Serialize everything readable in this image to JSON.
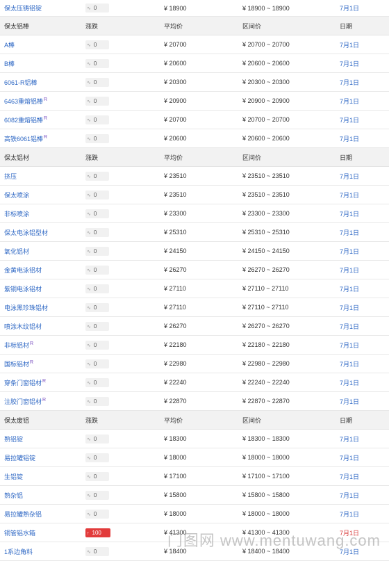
{
  "top_row": {
    "name": "保太压铸铝锭",
    "change": "0",
    "avg": "¥ 18900",
    "range": "¥ 18900 ~ 18900",
    "date": "7月1日"
  },
  "sections": [
    {
      "header": {
        "title": "保太铝棒",
        "change": "涨跌",
        "avg": "平均价",
        "range": "区间价",
        "date": "日期"
      },
      "rows": [
        {
          "name": "A棒",
          "ext": "",
          "change": "0",
          "avg": "¥ 20700",
          "range": "¥ 20700 ~ 20700",
          "date": "7月1日"
        },
        {
          "name": "B棒",
          "ext": "",
          "change": "0",
          "avg": "¥ 20600",
          "range": "¥ 20600 ~ 20600",
          "date": "7月1日"
        },
        {
          "name": "6061-R铝棒",
          "ext": "",
          "change": "0",
          "avg": "¥ 20300",
          "range": "¥ 20300 ~ 20300",
          "date": "7月1日"
        },
        {
          "name": "6463重熔铝棒",
          "ext": "R",
          "change": "0",
          "avg": "¥ 20900",
          "range": "¥ 20900 ~ 20900",
          "date": "7月1日"
        },
        {
          "name": "6082重熔铝棒",
          "ext": "R",
          "change": "0",
          "avg": "¥ 20700",
          "range": "¥ 20700 ~ 20700",
          "date": "7月1日"
        },
        {
          "name": "高铁6061铝棒",
          "ext": "R",
          "change": "0",
          "avg": "¥ 20600",
          "range": "¥ 20600 ~ 20600",
          "date": "7月1日"
        }
      ]
    },
    {
      "header": {
        "title": "保太铝材",
        "change": "涨跌",
        "avg": "平均价",
        "range": "区间价",
        "date": "日期"
      },
      "rows": [
        {
          "name": "挤压",
          "ext": "",
          "change": "0",
          "avg": "¥ 23510",
          "range": "¥ 23510 ~ 23510",
          "date": "7月1日"
        },
        {
          "name": "保太喷涂",
          "ext": "",
          "change": "0",
          "avg": "¥ 23510",
          "range": "¥ 23510 ~ 23510",
          "date": "7月1日"
        },
        {
          "name": "非标喷涂",
          "ext": "",
          "change": "0",
          "avg": "¥ 23300",
          "range": "¥ 23300 ~ 23300",
          "date": "7月1日"
        },
        {
          "name": "保太电泳铝型材",
          "ext": "",
          "change": "0",
          "avg": "¥ 25310",
          "range": "¥ 25310 ~ 25310",
          "date": "7月1日"
        },
        {
          "name": "氧化铝材",
          "ext": "",
          "change": "0",
          "avg": "¥ 24150",
          "range": "¥ 24150 ~ 24150",
          "date": "7月1日"
        },
        {
          "name": "金黄电泳铝材",
          "ext": "",
          "change": "0",
          "avg": "¥ 26270",
          "range": "¥ 26270 ~ 26270",
          "date": "7月1日"
        },
        {
          "name": "紫铜电泳铝材",
          "ext": "",
          "change": "0",
          "avg": "¥ 27110",
          "range": "¥ 27110 ~ 27110",
          "date": "7月1日"
        },
        {
          "name": "电泳黑珍珠铝材",
          "ext": "",
          "change": "0",
          "avg": "¥ 27110",
          "range": "¥ 27110 ~ 27110",
          "date": "7月1日"
        },
        {
          "name": "喷涂木纹铝材",
          "ext": "",
          "change": "0",
          "avg": "¥ 26270",
          "range": "¥ 26270 ~ 26270",
          "date": "7月1日"
        },
        {
          "name": "非标铝材",
          "ext": "R",
          "change": "0",
          "avg": "¥ 22180",
          "range": "¥ 22180 ~ 22180",
          "date": "7月1日"
        },
        {
          "name": "国标铝材",
          "ext": "R",
          "change": "0",
          "avg": "¥ 22980",
          "range": "¥ 22980 ~ 22980",
          "date": "7月1日"
        },
        {
          "name": "穿条门窗铝材",
          "ext": "R",
          "change": "0",
          "avg": "¥ 22240",
          "range": "¥ 22240 ~ 22240",
          "date": "7月1日"
        },
        {
          "name": "注胶门窗铝材",
          "ext": "R",
          "change": "0",
          "avg": "¥ 22870",
          "range": "¥ 22870 ~ 22870",
          "date": "7月1日"
        }
      ]
    },
    {
      "header": {
        "title": "保太废铝",
        "change": "涨跌",
        "avg": "平均价",
        "range": "区间价",
        "date": "日期"
      },
      "rows": [
        {
          "name": "熟铝锭",
          "ext": "",
          "change": "0",
          "avg": "¥ 18300",
          "range": "¥ 18300 ~ 18300",
          "date": "7月1日"
        },
        {
          "name": "易拉罐铝锭",
          "ext": "",
          "change": "0",
          "avg": "¥ 18000",
          "range": "¥ 18000 ~ 18000",
          "date": "7月1日"
        },
        {
          "name": "生铝锭",
          "ext": "",
          "change": "0",
          "avg": "¥ 17100",
          "range": "¥ 17100 ~ 17100",
          "date": "7月1日"
        },
        {
          "name": "熟杂铝",
          "ext": "",
          "change": "0",
          "avg": "¥ 15800",
          "range": "¥ 15800 ~ 15800",
          "date": "7月1日"
        },
        {
          "name": "易拉罐熟杂铝",
          "ext": "",
          "change": "0",
          "avg": "¥ 18000",
          "range": "¥ 18000 ~ 18000",
          "date": "7月1日"
        },
        {
          "name": "铜管铝水箱",
          "ext": "",
          "change": "100",
          "up": true,
          "avg": "¥ 41300",
          "range": "¥ 41300 ~ 41300",
          "date": "7月1日"
        },
        {
          "name": "1系边角料",
          "ext": "",
          "change": "0",
          "avg": "¥ 18400",
          "range": "¥ 18400 ~ 18400",
          "date": "7月1日"
        }
      ]
    }
  ],
  "watermark": "门图网 www.mentuwang.com",
  "colors": {
    "link": "#2d67c4",
    "up": "#e23b3b",
    "header_bg": "#f2f2f2"
  }
}
